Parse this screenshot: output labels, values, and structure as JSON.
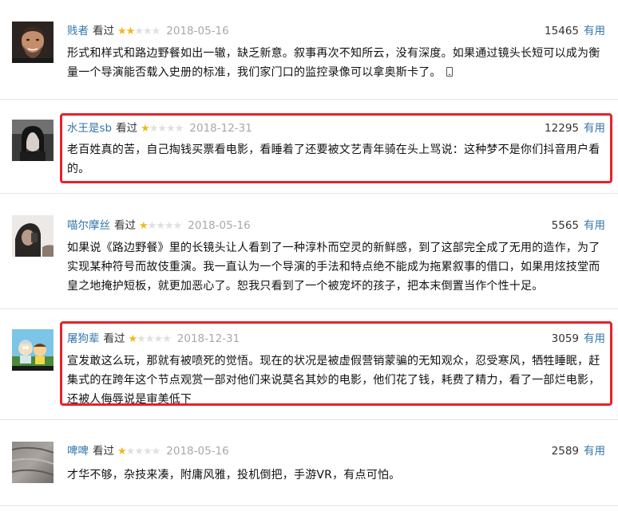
{
  "reviews": [
    {
      "author": "贱者",
      "watched": "看过",
      "rating": 2,
      "date": "2018-05-16",
      "votes": "15465",
      "useful": "有用",
      "content": "形式和样式和路边野餐如出一辙，缺乏新意。叙事再次不知所云，没有深度。如果通过镜头长短可以成为衡量一个导演能否载入史册的标准，我们家门口的监控录像可以拿奥斯卡了。",
      "avatar_desc": "man-with-beard-avatar",
      "mobile_icon": "mobile-phone-icon"
    },
    {
      "author": "水王是sb",
      "watched": "看过",
      "rating": 1,
      "date": "2018-12-31",
      "votes": "12295",
      "useful": "有用",
      "content": "老百姓真的苦，自己掏钱买票看电影，看睡着了还要被文艺青年骑在头上骂说：这种梦不是你们抖音用户看的。",
      "avatar_desc": "dark-portrait-avatar"
    },
    {
      "author": "喵尔摩丝",
      "watched": "看过",
      "rating": 1,
      "date": "2018-05-16",
      "votes": "5565",
      "useful": "有用",
      "content": "如果说《路边野餐》里的长镜头让人看到了一种淳朴而空灵的新鲜感，到了这部完全成了无用的造作，为了实现某种符号而故伎重演。我一直认为一个导演的手法和特点绝不能成为拖累叙事的借口，如果用炫技堂而皇之地掩护短板，就更加恶心了。恕我只看到了一个被宠坏的孩子，把本末倒置当作个性十足。",
      "avatar_desc": "person-on-phone-avatar"
    },
    {
      "author": "屠狗辈",
      "watched": "看过",
      "rating": 1,
      "date": "2018-12-31",
      "votes": "3059",
      "useful": "有用",
      "content": "宣发敢这么玩，那就有被喷死的觉悟。现在的状况是被虚假营销蒙骗的无知观众，忍受寒风，牺牲睡眠，赶集式的在跨年这个节点观赏一部对他们来说莫名其妙的电影，他们花了钱，耗费了精力，看了一部烂电影，还被人侮辱说是审美低下",
      "avatar_desc": "cartoon-avatar"
    },
    {
      "author": "啤啤",
      "watched": "看过",
      "rating": 1,
      "date": "2018-05-16",
      "votes": "2589",
      "useful": "有用",
      "content": "才华不够，杂技来凑，附庸风雅，投机倒把，手游VR，有点可怕。",
      "avatar_desc": "gray-texture-avatar"
    }
  ],
  "colors": {
    "link": "#3377aa",
    "star": "#f2b619",
    "star_empty": "#e0e0e0",
    "date": "#a8a8a8",
    "highlight": "#e8212a"
  }
}
